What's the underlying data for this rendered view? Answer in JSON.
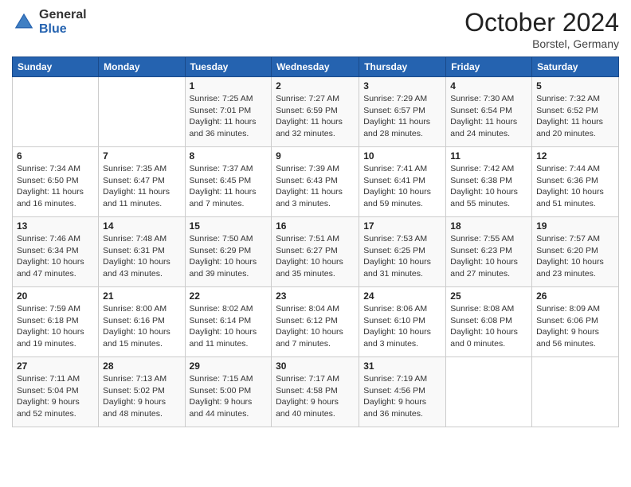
{
  "header": {
    "logo_general": "General",
    "logo_blue": "Blue",
    "month_title": "October 2024",
    "location": "Borstel, Germany"
  },
  "days_of_week": [
    "Sunday",
    "Monday",
    "Tuesday",
    "Wednesday",
    "Thursday",
    "Friday",
    "Saturday"
  ],
  "weeks": [
    [
      {
        "day": "",
        "info": ""
      },
      {
        "day": "",
        "info": ""
      },
      {
        "day": "1",
        "info": "Sunrise: 7:25 AM\nSunset: 7:01 PM\nDaylight: 11 hours and 36 minutes."
      },
      {
        "day": "2",
        "info": "Sunrise: 7:27 AM\nSunset: 6:59 PM\nDaylight: 11 hours and 32 minutes."
      },
      {
        "day": "3",
        "info": "Sunrise: 7:29 AM\nSunset: 6:57 PM\nDaylight: 11 hours and 28 minutes."
      },
      {
        "day": "4",
        "info": "Sunrise: 7:30 AM\nSunset: 6:54 PM\nDaylight: 11 hours and 24 minutes."
      },
      {
        "day": "5",
        "info": "Sunrise: 7:32 AM\nSunset: 6:52 PM\nDaylight: 11 hours and 20 minutes."
      }
    ],
    [
      {
        "day": "6",
        "info": "Sunrise: 7:34 AM\nSunset: 6:50 PM\nDaylight: 11 hours and 16 minutes."
      },
      {
        "day": "7",
        "info": "Sunrise: 7:35 AM\nSunset: 6:47 PM\nDaylight: 11 hours and 11 minutes."
      },
      {
        "day": "8",
        "info": "Sunrise: 7:37 AM\nSunset: 6:45 PM\nDaylight: 11 hours and 7 minutes."
      },
      {
        "day": "9",
        "info": "Sunrise: 7:39 AM\nSunset: 6:43 PM\nDaylight: 11 hours and 3 minutes."
      },
      {
        "day": "10",
        "info": "Sunrise: 7:41 AM\nSunset: 6:41 PM\nDaylight: 10 hours and 59 minutes."
      },
      {
        "day": "11",
        "info": "Sunrise: 7:42 AM\nSunset: 6:38 PM\nDaylight: 10 hours and 55 minutes."
      },
      {
        "day": "12",
        "info": "Sunrise: 7:44 AM\nSunset: 6:36 PM\nDaylight: 10 hours and 51 minutes."
      }
    ],
    [
      {
        "day": "13",
        "info": "Sunrise: 7:46 AM\nSunset: 6:34 PM\nDaylight: 10 hours and 47 minutes."
      },
      {
        "day": "14",
        "info": "Sunrise: 7:48 AM\nSunset: 6:31 PM\nDaylight: 10 hours and 43 minutes."
      },
      {
        "day": "15",
        "info": "Sunrise: 7:50 AM\nSunset: 6:29 PM\nDaylight: 10 hours and 39 minutes."
      },
      {
        "day": "16",
        "info": "Sunrise: 7:51 AM\nSunset: 6:27 PM\nDaylight: 10 hours and 35 minutes."
      },
      {
        "day": "17",
        "info": "Sunrise: 7:53 AM\nSunset: 6:25 PM\nDaylight: 10 hours and 31 minutes."
      },
      {
        "day": "18",
        "info": "Sunrise: 7:55 AM\nSunset: 6:23 PM\nDaylight: 10 hours and 27 minutes."
      },
      {
        "day": "19",
        "info": "Sunrise: 7:57 AM\nSunset: 6:20 PM\nDaylight: 10 hours and 23 minutes."
      }
    ],
    [
      {
        "day": "20",
        "info": "Sunrise: 7:59 AM\nSunset: 6:18 PM\nDaylight: 10 hours and 19 minutes."
      },
      {
        "day": "21",
        "info": "Sunrise: 8:00 AM\nSunset: 6:16 PM\nDaylight: 10 hours and 15 minutes."
      },
      {
        "day": "22",
        "info": "Sunrise: 8:02 AM\nSunset: 6:14 PM\nDaylight: 10 hours and 11 minutes."
      },
      {
        "day": "23",
        "info": "Sunrise: 8:04 AM\nSunset: 6:12 PM\nDaylight: 10 hours and 7 minutes."
      },
      {
        "day": "24",
        "info": "Sunrise: 8:06 AM\nSunset: 6:10 PM\nDaylight: 10 hours and 3 minutes."
      },
      {
        "day": "25",
        "info": "Sunrise: 8:08 AM\nSunset: 6:08 PM\nDaylight: 10 hours and 0 minutes."
      },
      {
        "day": "26",
        "info": "Sunrise: 8:09 AM\nSunset: 6:06 PM\nDaylight: 9 hours and 56 minutes."
      }
    ],
    [
      {
        "day": "27",
        "info": "Sunrise: 7:11 AM\nSunset: 5:04 PM\nDaylight: 9 hours and 52 minutes."
      },
      {
        "day": "28",
        "info": "Sunrise: 7:13 AM\nSunset: 5:02 PM\nDaylight: 9 hours and 48 minutes."
      },
      {
        "day": "29",
        "info": "Sunrise: 7:15 AM\nSunset: 5:00 PM\nDaylight: 9 hours and 44 minutes."
      },
      {
        "day": "30",
        "info": "Sunrise: 7:17 AM\nSunset: 4:58 PM\nDaylight: 9 hours and 40 minutes."
      },
      {
        "day": "31",
        "info": "Sunrise: 7:19 AM\nSunset: 4:56 PM\nDaylight: 9 hours and 36 minutes."
      },
      {
        "day": "",
        "info": ""
      },
      {
        "day": "",
        "info": ""
      }
    ]
  ]
}
